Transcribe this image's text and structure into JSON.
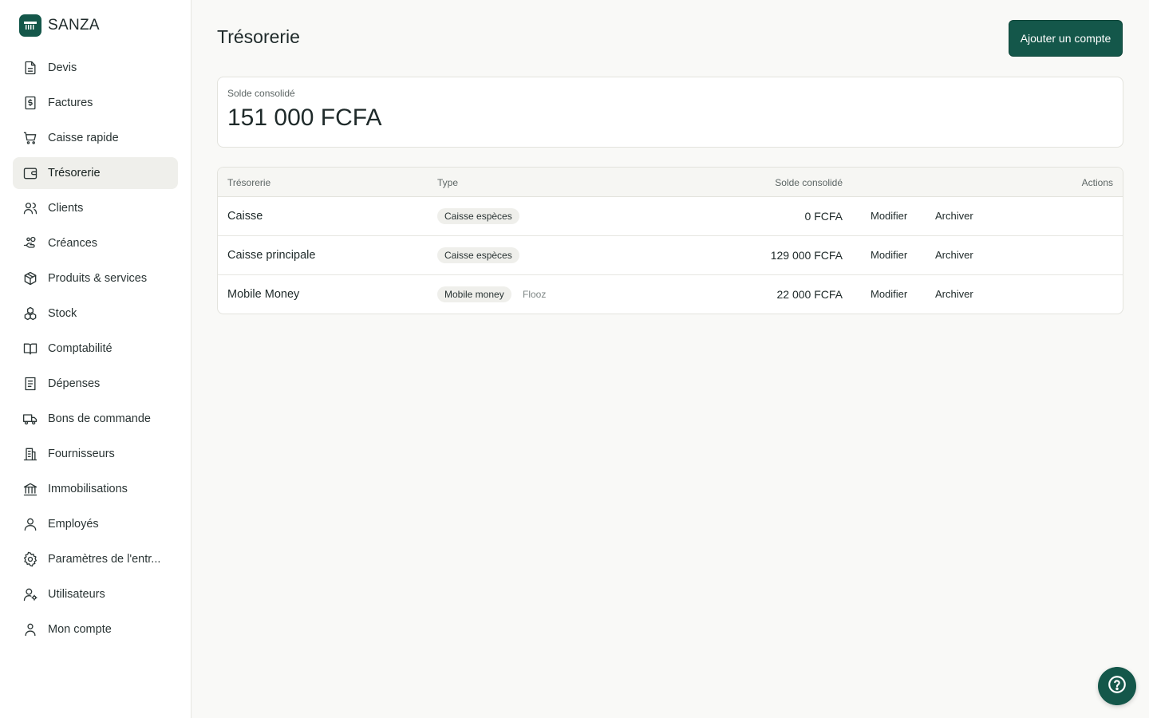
{
  "brand": {
    "name": "SANZA",
    "logo_icon": "cash-register-icon"
  },
  "sidebar": {
    "items": [
      {
        "label": "Devis",
        "icon": "document-icon",
        "active": false
      },
      {
        "label": "Factures",
        "icon": "invoice-dollar-icon",
        "active": false
      },
      {
        "label": "Caisse rapide",
        "icon": "cart-icon",
        "active": false
      },
      {
        "label": "Trésorerie",
        "icon": "wallet-icon",
        "active": true
      },
      {
        "label": "Clients",
        "icon": "users-icon",
        "active": false
      },
      {
        "label": "Créances",
        "icon": "hand-coins-icon",
        "active": false
      },
      {
        "label": "Produits & services",
        "icon": "package-icon",
        "active": false
      },
      {
        "label": "Stock",
        "icon": "boxes-icon",
        "active": false
      },
      {
        "label": "Comptabilité",
        "icon": "book-icon",
        "active": false
      },
      {
        "label": "Dépenses",
        "icon": "receipt-icon",
        "active": false
      },
      {
        "label": "Bons de commande",
        "icon": "truck-icon",
        "active": false
      },
      {
        "label": "Fournisseurs",
        "icon": "building-icon",
        "active": false
      },
      {
        "label": "Immobilisations",
        "icon": "bank-icon",
        "active": false
      },
      {
        "label": "Employés",
        "icon": "user-icon",
        "active": false
      },
      {
        "label": "Paramètres de l'entr...",
        "icon": "gear-icon",
        "active": false
      },
      {
        "label": "Utilisateurs",
        "icon": "user-cog-icon",
        "active": false
      },
      {
        "label": "Mon compte",
        "icon": "account-icon",
        "active": false
      }
    ]
  },
  "main": {
    "title": "Trésorerie",
    "add_button": "Ajouter un compte",
    "balance": {
      "label": "Solde consolidé",
      "value": "151 000 FCFA"
    },
    "table": {
      "headers": {
        "name": "Trésorerie",
        "type": "Type",
        "balance": "Solde consolidé",
        "actions": "Actions"
      },
      "rows": [
        {
          "name": "Caisse",
          "type": "Caisse espèces",
          "provider": "",
          "balance": "0 FCFA",
          "edit": "Modifier",
          "archive": "Archiver"
        },
        {
          "name": "Caisse principale",
          "type": "Caisse espèces",
          "provider": "",
          "balance": "129 000 FCFA",
          "edit": "Modifier",
          "archive": "Archiver"
        },
        {
          "name": "Mobile Money",
          "type": "Mobile money",
          "provider": "Flooz",
          "balance": "22 000 FCFA",
          "edit": "Modifier",
          "archive": "Archiver"
        }
      ]
    }
  },
  "help": {
    "icon": "help-circle-icon"
  },
  "colors": {
    "accent": "#14574a",
    "active_nav": "#efefeb",
    "background": "#f9f9f7"
  }
}
